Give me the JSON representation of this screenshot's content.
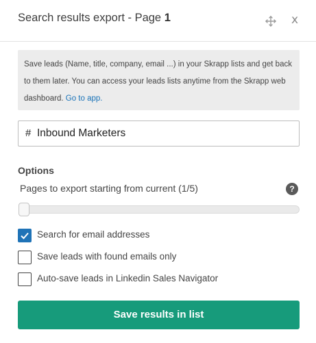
{
  "header": {
    "title_prefix": "Search results export - Page ",
    "page_number": "1",
    "move_icon": "move-arrows-icon",
    "close_label": "x"
  },
  "info": {
    "text": "Save leads (Name, title, company, email ...) in your Skrapp lists and get back to them later. You can access your leads lists anytime from the Skrapp web dashboard. ",
    "link_label": "Go to app."
  },
  "list_input": {
    "prefix": "#",
    "value": "Inbound Marketers"
  },
  "options": {
    "heading": "Options",
    "pages_label": "Pages to export starting from current (1/5)",
    "help_label": "?",
    "slider_value": 1,
    "slider_max": 5,
    "checkboxes": [
      {
        "label": "Search for email addresses",
        "checked": true
      },
      {
        "label": "Save leads with found emails only",
        "checked": false
      },
      {
        "label": "Auto-save leads in Linkedin Sales Navigator",
        "checked": false
      }
    ]
  },
  "actions": {
    "save_label": "Save results in list"
  },
  "colors": {
    "accent_green": "#179b7b",
    "checkbox_blue": "#1f73b7",
    "link_blue": "#1a73b8"
  }
}
